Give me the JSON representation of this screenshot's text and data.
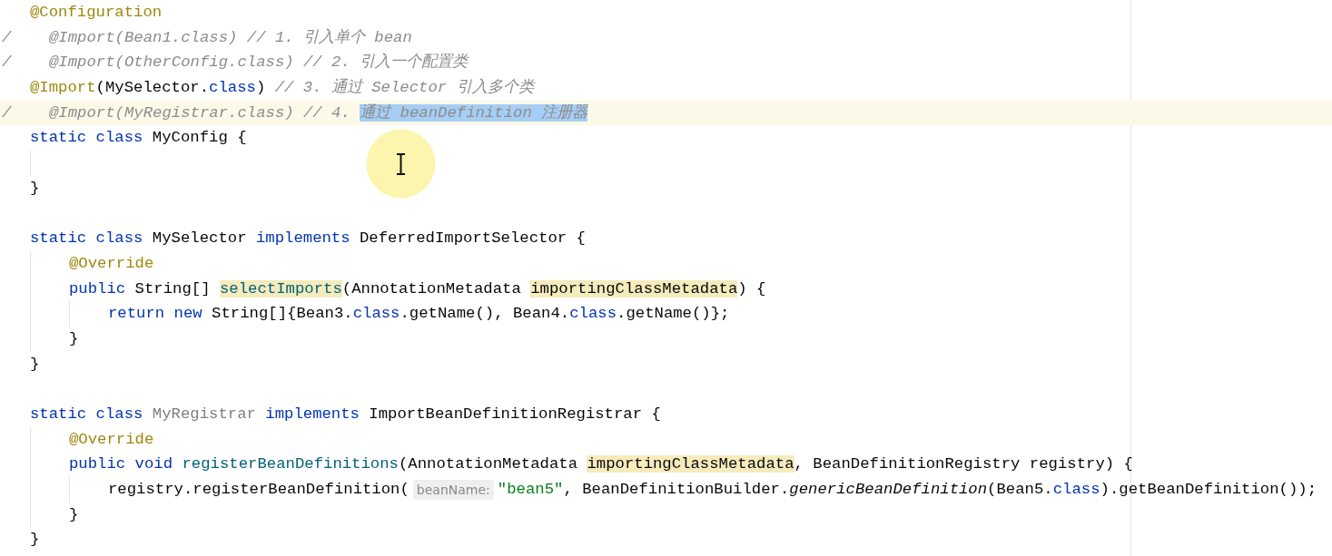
{
  "editor": {
    "lines": [
      {
        "kind": "code",
        "tokens": [
          {
            "kind": "annotation",
            "text": "@Configuration"
          }
        ]
      },
      {
        "kind": "code",
        "gutter_mark": "/",
        "tokens": [
          {
            "kind": "comment",
            "text": "@Import(Bean1.class) // 1. 引入单个 bean"
          }
        ]
      },
      {
        "kind": "code",
        "gutter_mark": "/",
        "tokens": [
          {
            "kind": "comment",
            "text": "@Import(OtherConfig.class) // 2. 引入一个配置类"
          }
        ]
      },
      {
        "kind": "code",
        "tokens": [
          {
            "kind": "annotation",
            "text": "@Import"
          },
          {
            "kind": "plain",
            "text": "(MySelector."
          },
          {
            "kind": "keyword",
            "text": "class"
          },
          {
            "kind": "plain",
            "text": ") "
          },
          {
            "kind": "comment",
            "text": "// 3. 通过 Selector 引入多个类"
          }
        ]
      },
      {
        "kind": "code",
        "current": true,
        "gutter_mark": "/",
        "tokens": [
          {
            "kind": "comment",
            "text": "@Import(MyRegistrar.class) // 4. "
          },
          {
            "kind": "comment_selected",
            "text": "通过 beanDefinition 注册器"
          }
        ]
      },
      {
        "kind": "code",
        "tokens": [
          {
            "kind": "keyword",
            "text": "static class "
          },
          {
            "kind": "plain",
            "text": "MyConfig {"
          }
        ],
        "children": [
          {
            "kind": "blank"
          }
        ]
      },
      {
        "kind": "code",
        "tokens": [
          {
            "kind": "plain",
            "text": "}"
          }
        ]
      },
      {
        "kind": "blank"
      },
      {
        "kind": "code",
        "tokens": [
          {
            "kind": "keyword",
            "text": "static class "
          },
          {
            "kind": "plain",
            "text": "MySelector "
          },
          {
            "kind": "keyword",
            "text": "implements "
          },
          {
            "kind": "plain",
            "text": "DeferredImportSelector {"
          }
        ],
        "children": [
          {
            "kind": "code",
            "tokens": [
              {
                "kind": "annotation",
                "text": "@Override"
              }
            ]
          },
          {
            "kind": "code",
            "tokens": [
              {
                "kind": "keyword",
                "text": "public "
              },
              {
                "kind": "plain",
                "text": "String[] "
              },
              {
                "kind": "method_marked",
                "text": "selectImports"
              },
              {
                "kind": "plain",
                "text": "(AnnotationMetadata "
              },
              {
                "kind": "param_marked",
                "text": "importingClassMetadata"
              },
              {
                "kind": "plain",
                "text": ") {"
              }
            ],
            "children": [
              {
                "kind": "code",
                "tokens": [
                  {
                    "kind": "keyword",
                    "text": "return new "
                  },
                  {
                    "kind": "plain",
                    "text": "String[]{Bean3."
                  },
                  {
                    "kind": "keyword",
                    "text": "class"
                  },
                  {
                    "kind": "plain",
                    "text": ".getName(), Bean4."
                  },
                  {
                    "kind": "keyword",
                    "text": "class"
                  },
                  {
                    "kind": "plain",
                    "text": ".getName()};"
                  }
                ]
              }
            ]
          },
          {
            "kind": "code",
            "tokens": [
              {
                "kind": "plain",
                "text": "}"
              }
            ]
          }
        ]
      },
      {
        "kind": "code",
        "tokens": [
          {
            "kind": "plain",
            "text": "}"
          }
        ]
      },
      {
        "kind": "blank"
      },
      {
        "kind": "code",
        "tokens": [
          {
            "kind": "keyword",
            "text": "static class "
          },
          {
            "kind": "unused",
            "text": "MyRegistrar "
          },
          {
            "kind": "keyword",
            "text": "implements "
          },
          {
            "kind": "plain",
            "text": "ImportBeanDefinitionRegistrar {"
          }
        ],
        "children": [
          {
            "kind": "code",
            "tokens": [
              {
                "kind": "annotation",
                "text": "@Override"
              }
            ]
          },
          {
            "kind": "code",
            "tokens": [
              {
                "kind": "keyword",
                "text": "public void "
              },
              {
                "kind": "method",
                "text": "registerBeanDefinitions"
              },
              {
                "kind": "plain",
                "text": "(AnnotationMetadata "
              },
              {
                "kind": "param_marked",
                "text": "importingClassMetadata"
              },
              {
                "kind": "plain",
                "text": ", BeanDefinitionRegistry registry) {"
              }
            ],
            "children": [
              {
                "kind": "code",
                "tokens": [
                  {
                    "kind": "plain",
                    "text": "registry.registerBeanDefinition("
                  },
                  {
                    "kind": "hint",
                    "text": "beanName:"
                  },
                  {
                    "kind": "string",
                    "text": "\"bean5\""
                  },
                  {
                    "kind": "plain",
                    "text": ", BeanDefinitionBuilder."
                  },
                  {
                    "kind": "static_call",
                    "text": "genericBeanDefinition"
                  },
                  {
                    "kind": "plain",
                    "text": "(Bean5."
                  },
                  {
                    "kind": "keyword",
                    "text": "class"
                  },
                  {
                    "kind": "plain",
                    "text": ").getBeanDefinition());"
                  }
                ]
              }
            ]
          },
          {
            "kind": "code",
            "tokens": [
              {
                "kind": "plain",
                "text": "}"
              }
            ]
          }
        ]
      },
      {
        "kind": "code",
        "tokens": [
          {
            "kind": "plain",
            "text": "}"
          }
        ]
      }
    ]
  }
}
